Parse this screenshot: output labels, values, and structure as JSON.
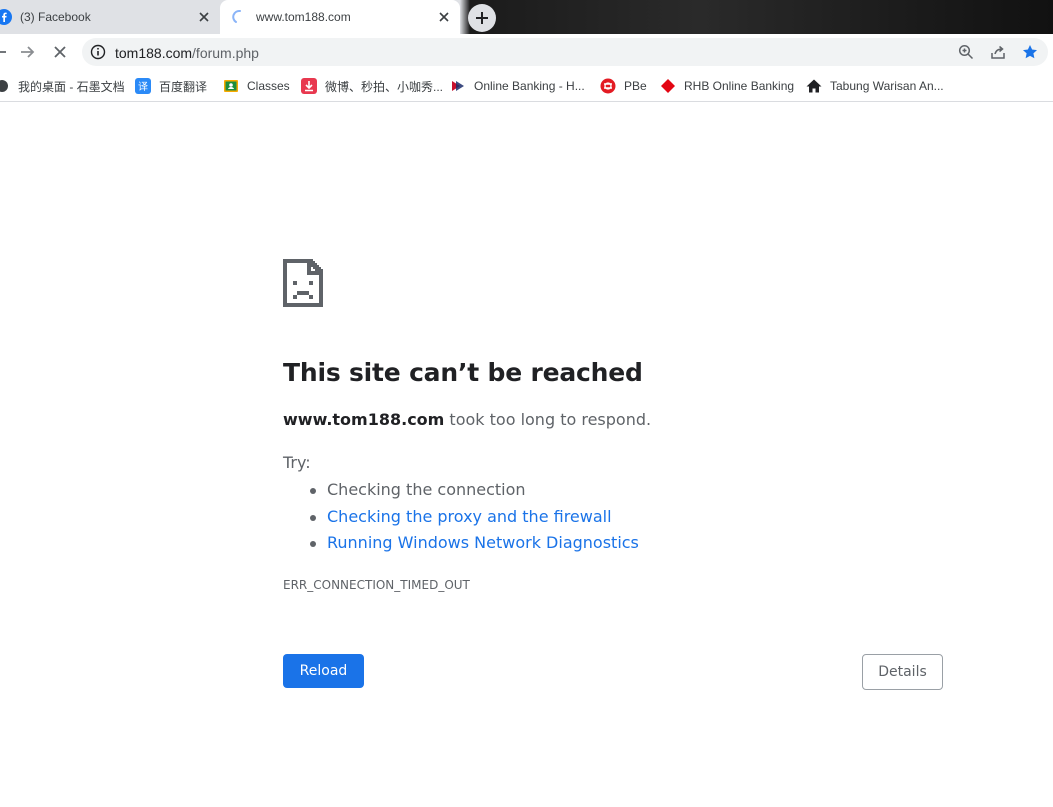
{
  "tabs": [
    {
      "title": "(3) Facebook",
      "icon": "facebook-icon",
      "active": false
    },
    {
      "title": "www.tom188.com",
      "icon": "loading-spinner-icon",
      "active": true
    }
  ],
  "omnibox": {
    "host": "tom188.com",
    "path": "/forum.php"
  },
  "bookmarks": [
    {
      "label": "我的桌面 - 石墨文档",
      "icon": "shimo-icon"
    },
    {
      "label": "百度翻译",
      "icon": "baidu-translate-icon"
    },
    {
      "label": "Classes",
      "icon": "google-classroom-icon"
    },
    {
      "label": "微博、秒拍、小咖秀...",
      "icon": "download-icon"
    },
    {
      "label": "Online Banking - H...",
      "icon": "bank-logo-icon"
    },
    {
      "label": "PBe",
      "icon": "pbe-icon"
    },
    {
      "label": "RHB Online Banking",
      "icon": "rhb-diamond-icon"
    },
    {
      "label": "Tabung Warisan An...",
      "icon": "house-icon"
    }
  ],
  "error": {
    "title": "This site can’t be reached",
    "host": "www.tom188.com",
    "message": " took too long to respond.",
    "try_label": "Try:",
    "suggestions": [
      {
        "text": "Checking the connection",
        "link": false
      },
      {
        "text": "Checking the proxy and the firewall",
        "link": true
      },
      {
        "text": "Running Windows Network Diagnostics",
        "link": true
      }
    ],
    "code": "ERR_CONNECTION_TIMED_OUT",
    "reload_label": "Reload",
    "details_label": "Details"
  },
  "colors": {
    "accent": "#1a73e8",
    "text_secondary": "#5f6368",
    "star": "#1a73e8"
  }
}
